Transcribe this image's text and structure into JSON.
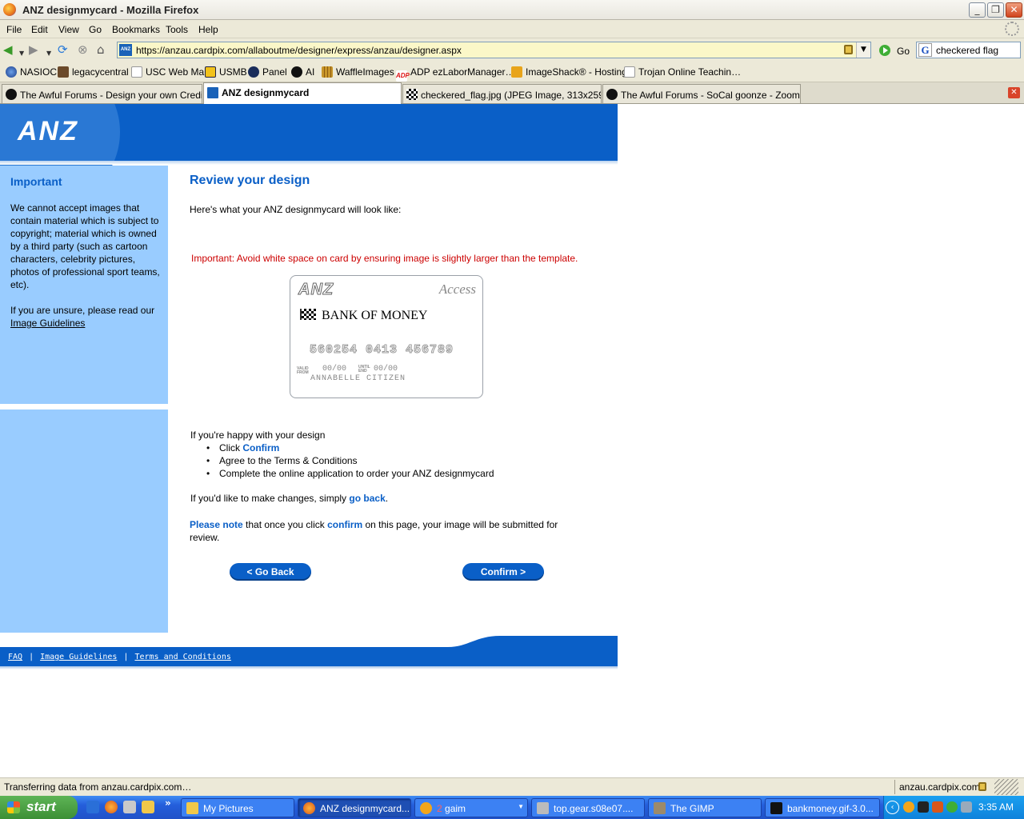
{
  "window": {
    "title": "ANZ designmycard - Mozilla Firefox",
    "minimize": "_",
    "restore": "❐",
    "close": "✕"
  },
  "menu": [
    "File",
    "Edit",
    "View",
    "Go",
    "Bookmarks",
    "Tools",
    "Help"
  ],
  "navbar": {
    "url": "https://anzau.cardpix.com/allaboutme/designer/express/anzau/designer.aspx",
    "go_label": "Go",
    "search_value": "checkered flag"
  },
  "bookmarks": [
    "NASIOC",
    "legacycentral",
    "USC Web Mail",
    "USMB",
    "Panel",
    "AI",
    "WaffleImages",
    "ADP ezLaborManager…",
    "ImageShack® - Hosting",
    "Trojan Online Teachin…"
  ],
  "tabs": [
    {
      "label": "The Awful Forums - Design your own Credit …"
    },
    {
      "label": "ANZ designmycard"
    },
    {
      "label": "checkered_flag.jpg (JPEG Image, 313x259 …"
    },
    {
      "label": "The Awful Forums - SoCal goonze - Zoom Z…"
    }
  ],
  "page": {
    "logo": "ANZ",
    "sidebar": {
      "title": "Important",
      "text": "We cannot accept images that contain material which is subject to copyright; material which is owned by a third party (such as cartoon characters, celebrity pictures, photos of professional sport teams, etc).",
      "unsure_text": "If you are unsure, please read our",
      "guidelines_link": "Image Guidelines"
    },
    "heading": "Review your design",
    "intro": "Here's what your ANZ designmycard will look like:",
    "warning": "Important: Avoid white space on card by ensuring image is slightly larger than the template.",
    "card": {
      "brand": "ANZ",
      "product": "Access",
      "bank_name": "BANK OF MONEY",
      "number": "560254 0413 456789",
      "valid_from_label": [
        "VALID",
        "FROM"
      ],
      "valid_from": "00/00",
      "until_end_label": [
        "UNTIL",
        "END"
      ],
      "until_end": "00/00",
      "holder": "ANNABELLE CITIZEN"
    },
    "happy_intro": "If you're happy with your design",
    "steps": {
      "click_prefix": "Click",
      "confirm_word": "Confirm",
      "agree": "Agree to the Terms & Conditions",
      "complete": "Complete the online application to order your ANZ designmycard"
    },
    "changes": {
      "prefix": "If you'd like to make changes, simply",
      "link": "go back",
      "suffix": "."
    },
    "note": {
      "label": "Please note",
      "mid": "that once you click",
      "confirm": "confirm",
      "rest": "on this page, your image will be submitted for review."
    },
    "buttons": {
      "back": "< Go Back",
      "confirm": "Confirm >"
    },
    "footer": {
      "faq": "FAQ",
      "guidelines": "Image Guidelines",
      "terms": "Terms and Conditions",
      "sep": "|"
    }
  },
  "status": {
    "message": "Transferring data from anzau.cardpix.com…",
    "host": "anzau.cardpix.com"
  },
  "taskbar": {
    "start": "start",
    "chevron": "»",
    "tasks": [
      {
        "label": "My Pictures"
      },
      {
        "label": "ANZ designmycard..."
      },
      {
        "count": "2",
        "label": "gaim"
      },
      {
        "label": "top.gear.s08e07...."
      },
      {
        "label": "The GIMP"
      },
      {
        "label": "bankmoney.gif-3.0..."
      }
    ],
    "clock": "3:35 AM"
  },
  "colors": {
    "anz_blue": "#0a5fc7",
    "sidebar_blue": "#99ccff",
    "warning_red": "#cc0000",
    "url_bar_secure": "#fbf7c8"
  }
}
